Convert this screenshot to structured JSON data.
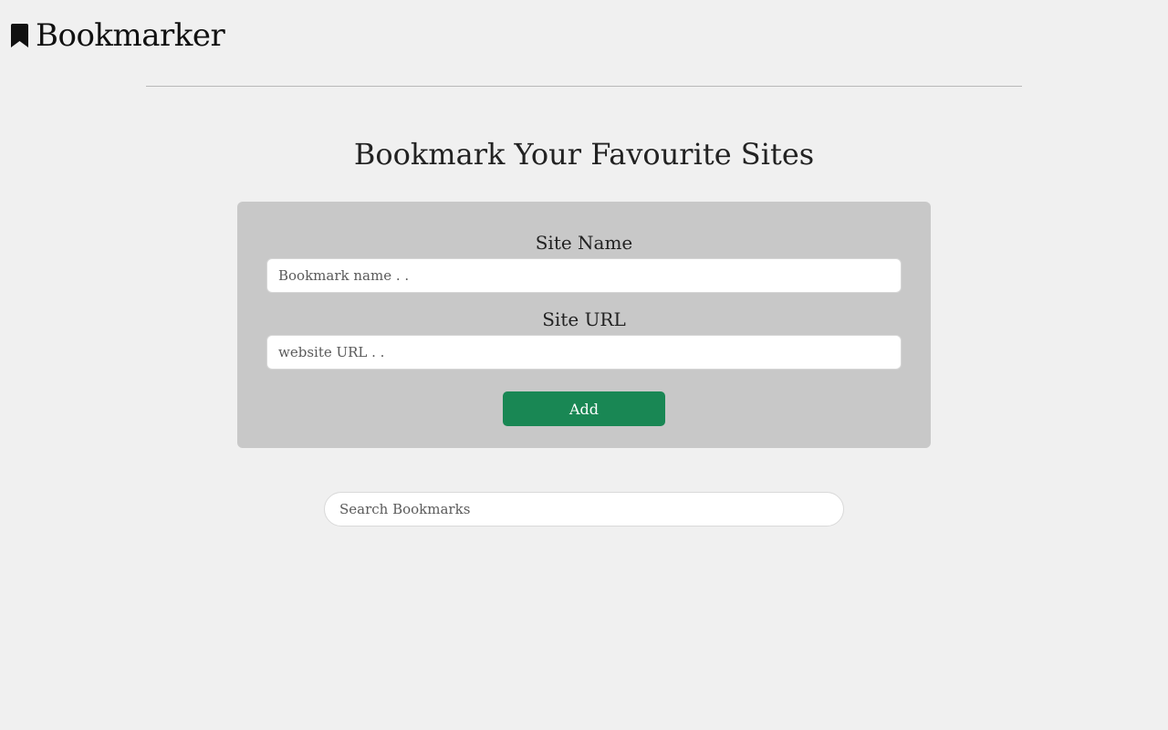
{
  "header": {
    "brand_title": "Bookmarker",
    "brand_icon": "bookmark-icon"
  },
  "main": {
    "heading": "Bookmark Your Favourite Sites",
    "form": {
      "site_name_label": "Site Name",
      "site_name_placeholder": "Bookmark name . .",
      "site_name_value": "",
      "site_url_label": "Site URL",
      "site_url_placeholder": "website URL . .",
      "site_url_value": "",
      "add_label": "Add"
    },
    "search": {
      "placeholder": "Search Bookmarks",
      "value": ""
    }
  },
  "colors": {
    "background": "#f0f0f0",
    "card": "#c8c8c8",
    "accent": "#198754"
  }
}
